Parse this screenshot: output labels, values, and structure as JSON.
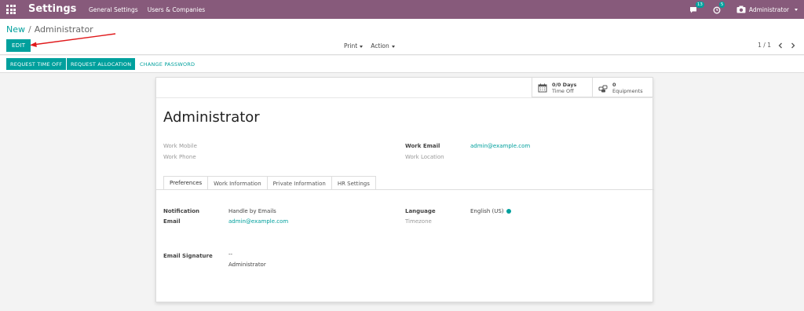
{
  "navbar": {
    "app_title": "Settings",
    "menu": [
      "General Settings",
      "Users & Companies"
    ],
    "messages_badge": "13",
    "activities_badge": "5",
    "user_name": "Administrator"
  },
  "breadcrumb": {
    "parent": "New",
    "current": "Administrator"
  },
  "toolbar": {
    "edit_label": "EDIT",
    "print_label": "Print",
    "action_label": "Action",
    "pager": "1 / 1"
  },
  "statusbar": {
    "request_time_off": "REQUEST TIME OFF",
    "request_allocation": "REQUEST ALLOCATION",
    "change_password": "CHANGE PASSWORD"
  },
  "stat_buttons": {
    "time_off_value": "0/0 Days",
    "time_off_label": "Time Off",
    "equipment_value": "0",
    "equipment_label": "Equipments"
  },
  "employee": {
    "name": "Administrator",
    "work_mobile_label": "Work Mobile",
    "work_phone_label": "Work Phone",
    "work_email_label": "Work Email",
    "work_email": "admin@example.com",
    "work_location_label": "Work Location"
  },
  "tabs": [
    "Preferences",
    "Work Information",
    "Private Information",
    "HR Settings"
  ],
  "preferences": {
    "notification_label": "Notification",
    "notification_value": "Handle by Emails",
    "email_label": "Email",
    "email_value": "admin@example.com",
    "language_label": "Language",
    "language_value": "English (US)",
    "timezone_label": "Timezone",
    "signature_label": "Email Signature",
    "signature_line1": "--",
    "signature_line2": "Administrator"
  },
  "colors": {
    "navbar": "#875a7b",
    "accent": "#00a09d",
    "annotation_arrow": "#e0191b"
  }
}
